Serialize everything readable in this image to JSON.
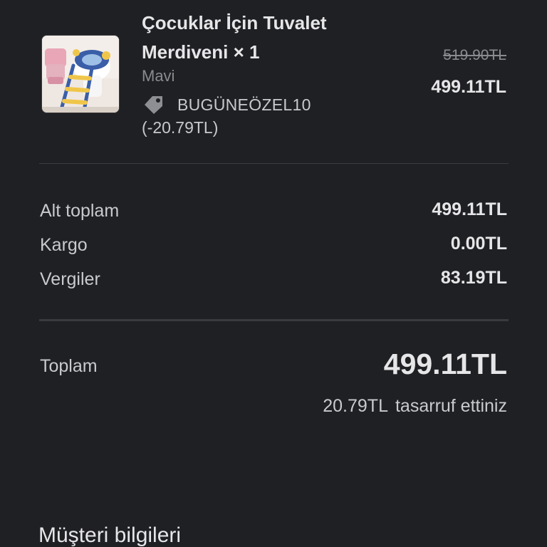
{
  "product": {
    "title_line1": "Çocuklar İçin Tuvalet",
    "title_line2": "Merdiveni × 1",
    "variant": "Mavi",
    "discount_code": "BUGÜNEÖZEL10",
    "discount_amount": "(-20.79TL)",
    "original_price": "519.90TL",
    "price": "499.11TL"
  },
  "summary": {
    "subtotal_label": "Alt toplam",
    "subtotal_value": "499.11TL",
    "shipping_label": "Kargo",
    "shipping_value": "0.00TL",
    "taxes_label": "Vergiler",
    "taxes_value": "83.19TL"
  },
  "total": {
    "label": "Toplam",
    "value": "499.11TL",
    "savings_amount": "20.79TL",
    "savings_text": "tasarruf ettiniz"
  },
  "customer": {
    "heading": "Müşteri bilgileri"
  },
  "icons": {
    "discount": "tag-icon",
    "product": "product-thumbnail"
  },
  "colors": {
    "background": "#1f2023",
    "text_primary": "#e6e6e8",
    "text_secondary": "#c9cacd",
    "text_muted": "#8a8b90",
    "divider": "#3b3c40"
  }
}
